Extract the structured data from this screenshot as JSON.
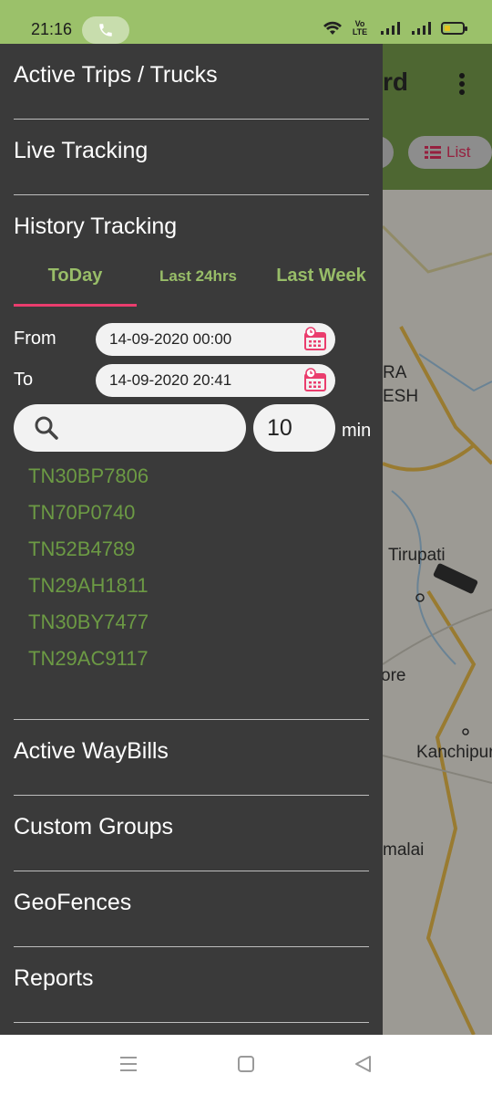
{
  "status_bar": {
    "time": "21:16",
    "network_label": "Vo LTE"
  },
  "app_bar": {
    "title_fragment": "rd"
  },
  "filter_bar": {
    "list_label": "List"
  },
  "map": {
    "labels": [
      "RA",
      "ESH",
      "Tirupati",
      "ore",
      "Kanchipura",
      "malai"
    ]
  },
  "drawer": {
    "menu": {
      "active_trips": "Active Trips / Trucks",
      "live_tracking": "Live Tracking",
      "history_tracking": "History Tracking",
      "active_waybills": "Active WayBills",
      "custom_groups": "Custom Groups",
      "geofences": "GeoFences",
      "reports": "Reports"
    },
    "history": {
      "tabs": [
        "ToDay",
        "Last 24hrs",
        "Last Week"
      ],
      "selected_tab": "ToDay",
      "from_label": "From",
      "from_value": "14-09-2020 00:00",
      "to_label": "To",
      "to_value": "14-09-2020 20:41",
      "search_value": "",
      "interval_value": "10",
      "interval_unit": "min",
      "vehicles": [
        "TN30BP7806",
        "TN70P0740",
        "TN52B4789",
        "TN29AH1811",
        "TN30BY7477",
        "TN29AC9117"
      ]
    }
  },
  "colors": {
    "accent_green": "#98bd68",
    "app_green": "#759a4b",
    "tab_indicator": "#ea3d6d",
    "vehicle_text": "#6c9a44",
    "drawer_bg": "#3a3a3a"
  }
}
